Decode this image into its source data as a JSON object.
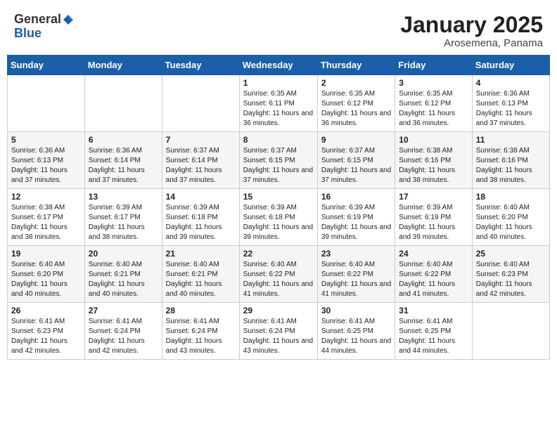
{
  "header": {
    "logo_general": "General",
    "logo_blue": "Blue",
    "month": "January 2025",
    "location": "Arosemena, Panama"
  },
  "days_of_week": [
    "Sunday",
    "Monday",
    "Tuesday",
    "Wednesday",
    "Thursday",
    "Friday",
    "Saturday"
  ],
  "weeks": [
    [
      {
        "day": "",
        "info": ""
      },
      {
        "day": "",
        "info": ""
      },
      {
        "day": "",
        "info": ""
      },
      {
        "day": "1",
        "info": "Sunrise: 6:35 AM\nSunset: 6:11 PM\nDaylight: 11 hours and 36 minutes."
      },
      {
        "day": "2",
        "info": "Sunrise: 6:35 AM\nSunset: 6:12 PM\nDaylight: 11 hours and 36 minutes."
      },
      {
        "day": "3",
        "info": "Sunrise: 6:35 AM\nSunset: 6:12 PM\nDaylight: 11 hours and 36 minutes."
      },
      {
        "day": "4",
        "info": "Sunrise: 6:36 AM\nSunset: 6:13 PM\nDaylight: 11 hours and 37 minutes."
      }
    ],
    [
      {
        "day": "5",
        "info": "Sunrise: 6:36 AM\nSunset: 6:13 PM\nDaylight: 11 hours and 37 minutes."
      },
      {
        "day": "6",
        "info": "Sunrise: 6:36 AM\nSunset: 6:14 PM\nDaylight: 11 hours and 37 minutes."
      },
      {
        "day": "7",
        "info": "Sunrise: 6:37 AM\nSunset: 6:14 PM\nDaylight: 11 hours and 37 minutes."
      },
      {
        "day": "8",
        "info": "Sunrise: 6:37 AM\nSunset: 6:15 PM\nDaylight: 11 hours and 37 minutes."
      },
      {
        "day": "9",
        "info": "Sunrise: 6:37 AM\nSunset: 6:15 PM\nDaylight: 11 hours and 37 minutes."
      },
      {
        "day": "10",
        "info": "Sunrise: 6:38 AM\nSunset: 6:16 PM\nDaylight: 11 hours and 38 minutes."
      },
      {
        "day": "11",
        "info": "Sunrise: 6:38 AM\nSunset: 6:16 PM\nDaylight: 11 hours and 38 minutes."
      }
    ],
    [
      {
        "day": "12",
        "info": "Sunrise: 6:38 AM\nSunset: 6:17 PM\nDaylight: 11 hours and 38 minutes."
      },
      {
        "day": "13",
        "info": "Sunrise: 6:39 AM\nSunset: 6:17 PM\nDaylight: 11 hours and 38 minutes."
      },
      {
        "day": "14",
        "info": "Sunrise: 6:39 AM\nSunset: 6:18 PM\nDaylight: 11 hours and 39 minutes."
      },
      {
        "day": "15",
        "info": "Sunrise: 6:39 AM\nSunset: 6:18 PM\nDaylight: 11 hours and 39 minutes."
      },
      {
        "day": "16",
        "info": "Sunrise: 6:39 AM\nSunset: 6:19 PM\nDaylight: 11 hours and 39 minutes."
      },
      {
        "day": "17",
        "info": "Sunrise: 6:39 AM\nSunset: 6:19 PM\nDaylight: 11 hours and 39 minutes."
      },
      {
        "day": "18",
        "info": "Sunrise: 6:40 AM\nSunset: 6:20 PM\nDaylight: 11 hours and 40 minutes."
      }
    ],
    [
      {
        "day": "19",
        "info": "Sunrise: 6:40 AM\nSunset: 6:20 PM\nDaylight: 11 hours and 40 minutes."
      },
      {
        "day": "20",
        "info": "Sunrise: 6:40 AM\nSunset: 6:21 PM\nDaylight: 11 hours and 40 minutes."
      },
      {
        "day": "21",
        "info": "Sunrise: 6:40 AM\nSunset: 6:21 PM\nDaylight: 11 hours and 40 minutes."
      },
      {
        "day": "22",
        "info": "Sunrise: 6:40 AM\nSunset: 6:22 PM\nDaylight: 11 hours and 41 minutes."
      },
      {
        "day": "23",
        "info": "Sunrise: 6:40 AM\nSunset: 6:22 PM\nDaylight: 11 hours and 41 minutes."
      },
      {
        "day": "24",
        "info": "Sunrise: 6:40 AM\nSunset: 6:22 PM\nDaylight: 11 hours and 41 minutes."
      },
      {
        "day": "25",
        "info": "Sunrise: 6:40 AM\nSunset: 6:23 PM\nDaylight: 11 hours and 42 minutes."
      }
    ],
    [
      {
        "day": "26",
        "info": "Sunrise: 6:41 AM\nSunset: 6:23 PM\nDaylight: 11 hours and 42 minutes."
      },
      {
        "day": "27",
        "info": "Sunrise: 6:41 AM\nSunset: 6:24 PM\nDaylight: 11 hours and 42 minutes."
      },
      {
        "day": "28",
        "info": "Sunrise: 6:41 AM\nSunset: 6:24 PM\nDaylight: 11 hours and 43 minutes."
      },
      {
        "day": "29",
        "info": "Sunrise: 6:41 AM\nSunset: 6:24 PM\nDaylight: 11 hours and 43 minutes."
      },
      {
        "day": "30",
        "info": "Sunrise: 6:41 AM\nSunset: 6:25 PM\nDaylight: 11 hours and 44 minutes."
      },
      {
        "day": "31",
        "info": "Sunrise: 6:41 AM\nSunset: 6:25 PM\nDaylight: 11 hours and 44 minutes."
      },
      {
        "day": "",
        "info": ""
      }
    ]
  ]
}
